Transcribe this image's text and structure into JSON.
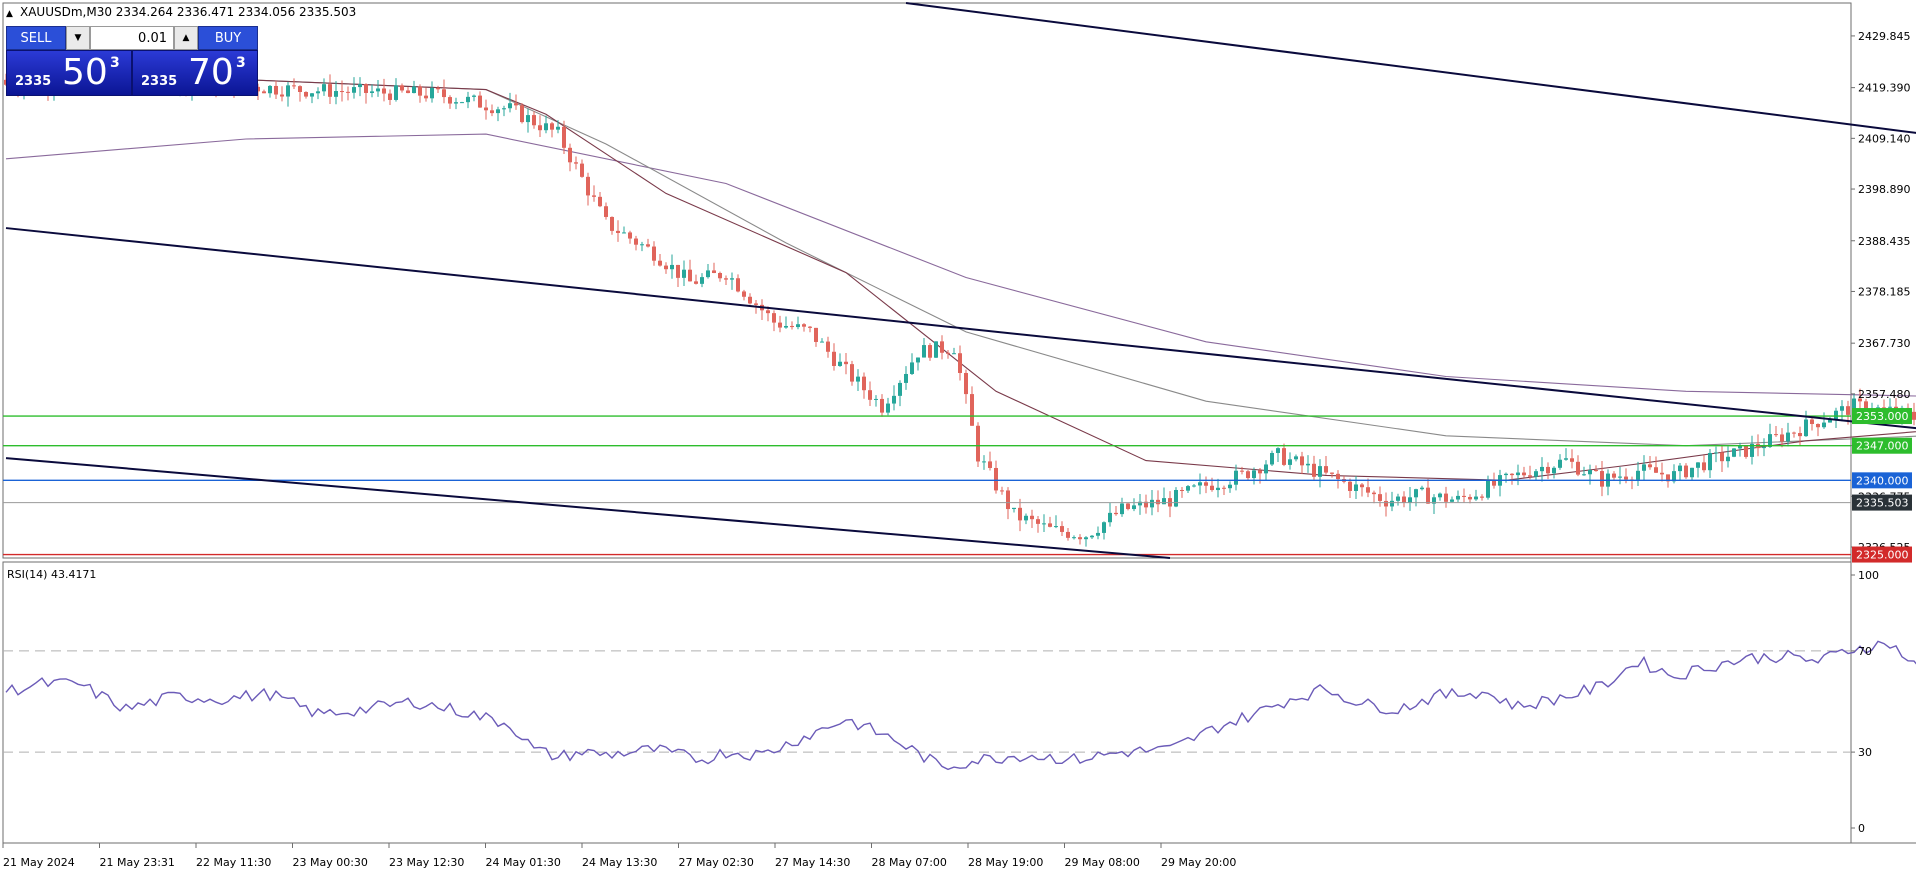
{
  "header": {
    "symbol_line": "XAUUSDm,M30  2334.264 2336.471 2334.056 2335.503"
  },
  "trade_panel": {
    "sell_label": "SELL",
    "buy_label": "BUY",
    "lot_value": "0.01",
    "sell_price_small": "2335",
    "sell_price_big": "50",
    "sell_price_sup": "3",
    "buy_price_small": "2335",
    "buy_price_big": "70",
    "buy_price_sup": "3"
  },
  "rsi_panel": {
    "label": "RSI(14) 43.4171"
  },
  "chart_data": [
    {
      "type": "candlestick",
      "symbol": "XAUUSDm",
      "timeframe": "M30",
      "ylim": [
        2324.3,
        2436.5
      ],
      "y_ticks": [
        "2429.845",
        "2419.390",
        "2409.140",
        "2398.890",
        "2388.435",
        "2378.185",
        "2367.730",
        "2357.480",
        "2347.025",
        "2336.775",
        "2326.525"
      ],
      "x_ticks": [
        "21 May 2024",
        "21 May 23:31",
        "22 May 11:30",
        "23 May 00:30",
        "23 May 12:30",
        "24 May 01:30",
        "24 May 13:30",
        "27 May 02:30",
        "27 May 14:30",
        "28 May 07:00",
        "28 May 19:00",
        "29 May 08:00",
        "29 May 20:00"
      ],
      "close_path": [
        [
          0,
          2420
        ],
        [
          24,
          2421
        ],
        [
          48,
          2419
        ],
        [
          72,
          2418
        ],
        [
          84,
          2415
        ],
        [
          92,
          2410
        ],
        [
          100,
          2392
        ],
        [
          108,
          2386
        ],
        [
          114,
          2380
        ],
        [
          120,
          2382
        ],
        [
          128,
          2372
        ],
        [
          134,
          2370
        ],
        [
          140,
          2362
        ],
        [
          146,
          2355
        ],
        [
          152,
          2366
        ],
        [
          158,
          2367
        ],
        [
          162,
          2345
        ],
        [
          168,
          2333
        ],
        [
          174,
          2330
        ],
        [
          180,
          2329
        ],
        [
          186,
          2334
        ],
        [
          194,
          2336
        ],
        [
          200,
          2339
        ],
        [
          206,
          2341
        ],
        [
          212,
          2345
        ],
        [
          218,
          2342
        ],
        [
          224,
          2339
        ],
        [
          230,
          2336
        ],
        [
          236,
          2337
        ],
        [
          242,
          2336
        ],
        [
          248,
          2339
        ],
        [
          254,
          2342
        ],
        [
          260,
          2344
        ],
        [
          266,
          2340
        ],
        [
          272,
          2342
        ],
        [
          278,
          2341
        ],
        [
          284,
          2344
        ],
        [
          290,
          2346
        ],
        [
          296,
          2349
        ],
        [
          302,
          2352
        ],
        [
          308,
          2355
        ],
        [
          314,
          2354
        ],
        [
          320,
          2352
        ],
        [
          326,
          2351
        ],
        [
          332,
          2353
        ],
        [
          338,
          2352
        ],
        [
          344,
          2350
        ],
        [
          350,
          2347
        ],
        [
          356,
          2343
        ],
        [
          362,
          2343
        ],
        [
          368,
          2348
        ],
        [
          372,
          2356
        ],
        [
          378,
          2359
        ],
        [
          384,
          2357
        ],
        [
          390,
          2361
        ],
        [
          396,
          2359
        ],
        [
          402,
          2358
        ],
        [
          408,
          2359
        ],
        [
          414,
          2357
        ],
        [
          420,
          2356
        ],
        [
          426,
          2357
        ],
        [
          432,
          2350
        ],
        [
          438,
          2345
        ],
        [
          444,
          2343
        ],
        [
          450,
          2344
        ],
        [
          456,
          2340
        ],
        [
          462,
          2345
        ],
        [
          468,
          2342
        ],
        [
          474,
          2339
        ],
        [
          480,
          2339
        ],
        [
          486,
          2337
        ],
        [
          492,
          2336
        ],
        [
          496,
          2333
        ],
        [
          500,
          2335
        ]
      ],
      "ma_curves": [
        {
          "color": "#8a6a9c",
          "values": [
            [
              0,
              2405
            ],
            [
              40,
              2409
            ],
            [
              80,
              2410
            ],
            [
              120,
              2400
            ],
            [
              160,
              2381
            ],
            [
              200,
              2368
            ],
            [
              240,
              2361
            ],
            [
              280,
              2358
            ],
            [
              320,
              2357
            ],
            [
              360,
              2358
            ],
            [
              400,
              2359
            ],
            [
              440,
              2357
            ],
            [
              500,
              2354
            ]
          ]
        },
        {
          "color": "#8a8a8a",
          "values": [
            [
              0,
              2420
            ],
            [
              40,
              2421
            ],
            [
              80,
              2419
            ],
            [
              100,
              2408
            ],
            [
              130,
              2388
            ],
            [
              160,
              2370
            ],
            [
              200,
              2356
            ],
            [
              240,
              2349
            ],
            [
              280,
              2347
            ],
            [
              320,
              2349
            ],
            [
              360,
              2350
            ],
            [
              400,
              2353
            ],
            [
              440,
              2354
            ],
            [
              470,
              2351
            ],
            [
              500,
              2347
            ]
          ]
        },
        {
          "color": "#7a3a4a",
          "values": [
            [
              0,
              2420
            ],
            [
              40,
              2421
            ],
            [
              80,
              2419
            ],
            [
              90,
              2414
            ],
            [
              110,
              2398
            ],
            [
              140,
              2382
            ],
            [
              165,
              2358
            ],
            [
              190,
              2344
            ],
            [
              220,
              2341
            ],
            [
              250,
              2340
            ],
            [
              270,
              2343
            ],
            [
              300,
              2348
            ],
            [
              330,
              2351
            ],
            [
              360,
              2349
            ],
            [
              390,
              2355
            ],
            [
              420,
              2357
            ],
            [
              440,
              2353
            ],
            [
              470,
              2348
            ],
            [
              500,
              2342
            ]
          ]
        }
      ],
      "horizontal_levels": [
        {
          "price": "2353.000",
          "color": "#2dbd2d"
        },
        {
          "price": "2347.000",
          "color": "#2dbd2d"
        },
        {
          "price": "2340.000",
          "color": "#1a63d6"
        },
        {
          "price": "2325.000",
          "color": "#d22a2a"
        }
      ],
      "current_price": {
        "price": "2335.503",
        "color": "#2a3238"
      },
      "trendlines": [
        {
          "from": [
            150,
            2436.5
          ],
          "to": [
            775,
            2339.0
          ],
          "color": "#0a0a3c"
        },
        {
          "from": [
            0,
            2391.0
          ],
          "to": [
            525,
            2324.3
          ],
          "color": "#0a0a3c"
        },
        {
          "from": [
            0,
            2344.5
          ],
          "to": [
            194,
            2324.3
          ],
          "color": "#0a0a3c"
        }
      ]
    },
    {
      "type": "line",
      "title": "RSI(14) 43.4171",
      "ylim": [
        0,
        100
      ],
      "y_ticks": [
        "100",
        "70",
        "30",
        "0"
      ],
      "levels": [
        70,
        30
      ],
      "color": "#6b5bb8",
      "series": [
        [
          0,
          54
        ],
        [
          6,
          57
        ],
        [
          12,
          57
        ],
        [
          20,
          47
        ],
        [
          28,
          52
        ],
        [
          36,
          51
        ],
        [
          44,
          53
        ],
        [
          52,
          45
        ],
        [
          60,
          47
        ],
        [
          68,
          50
        ],
        [
          76,
          46
        ],
        [
          84,
          41
        ],
        [
          88,
          31
        ],
        [
          92,
          28
        ],
        [
          96,
          30
        ],
        [
          100,
          29
        ],
        [
          108,
          31
        ],
        [
          116,
          27
        ],
        [
          120,
          30
        ],
        [
          126,
          29
        ],
        [
          132,
          35
        ],
        [
          140,
          43
        ],
        [
          148,
          35
        ],
        [
          156,
          24
        ],
        [
          162,
          27
        ],
        [
          170,
          29
        ],
        [
          178,
          27
        ],
        [
          186,
          30
        ],
        [
          194,
          31
        ],
        [
          202,
          40
        ],
        [
          208,
          45
        ],
        [
          214,
          51
        ],
        [
          220,
          55
        ],
        [
          226,
          49
        ],
        [
          232,
          47
        ],
        [
          238,
          52
        ],
        [
          246,
          54
        ],
        [
          252,
          48
        ],
        [
          260,
          52
        ],
        [
          266,
          56
        ],
        [
          272,
          66
        ],
        [
          278,
          60
        ],
        [
          284,
          64
        ],
        [
          290,
          67
        ],
        [
          296,
          68
        ],
        [
          302,
          66
        ],
        [
          308,
          71
        ],
        [
          314,
          73
        ],
        [
          320,
          60
        ],
        [
          326,
          59
        ],
        [
          332,
          56
        ],
        [
          338,
          53
        ],
        [
          344,
          48
        ],
        [
          350,
          33
        ],
        [
          356,
          35
        ],
        [
          362,
          44
        ],
        [
          368,
          60
        ],
        [
          372,
          66
        ],
        [
          378,
          60
        ],
        [
          384,
          62
        ],
        [
          390,
          59
        ],
        [
          396,
          62
        ],
        [
          402,
          61
        ],
        [
          408,
          58
        ],
        [
          414,
          54
        ],
        [
          420,
          48
        ],
        [
          426,
          53
        ],
        [
          432,
          42
        ],
        [
          438,
          31
        ],
        [
          444,
          34
        ],
        [
          450,
          30
        ],
        [
          456,
          41
        ],
        [
          462,
          40
        ],
        [
          468,
          42
        ],
        [
          474,
          43
        ],
        [
          480,
          40
        ],
        [
          486,
          38
        ],
        [
          492,
          31
        ],
        [
          496,
          35
        ],
        [
          500,
          43
        ]
      ]
    }
  ]
}
